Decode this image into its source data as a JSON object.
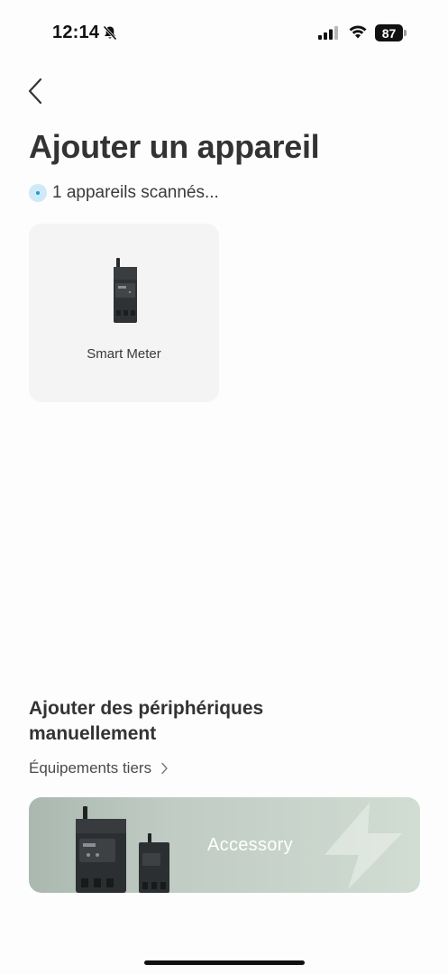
{
  "status_bar": {
    "time": "12:14",
    "battery_level": "87",
    "icons": [
      "bell-slash-icon",
      "cellular-signal-icon",
      "wifi-icon",
      "battery-icon"
    ]
  },
  "header": {
    "back_icon": "chevron-left-icon",
    "title": "Ajouter un appareil"
  },
  "scan": {
    "icon": "scanning-icon",
    "status_text": "1 appareils scannés..."
  },
  "devices": [
    {
      "name": "Smart Meter",
      "icon": "smart-meter-icon"
    }
  ],
  "manual": {
    "title": "Ajouter des périphériques manuellement",
    "third_party_label": "Équipements tiers",
    "third_party_icon": "chevron-right-icon"
  },
  "banner": {
    "label": "Accessory"
  },
  "colors": {
    "background": "#fdfdfd",
    "card_background": "#f4f4f4",
    "title_text": "#333333",
    "scan_accent": "#1d9ad6",
    "banner_gradient_start": "#aab8b0",
    "banner_gradient_end": "#d1ddd3"
  }
}
